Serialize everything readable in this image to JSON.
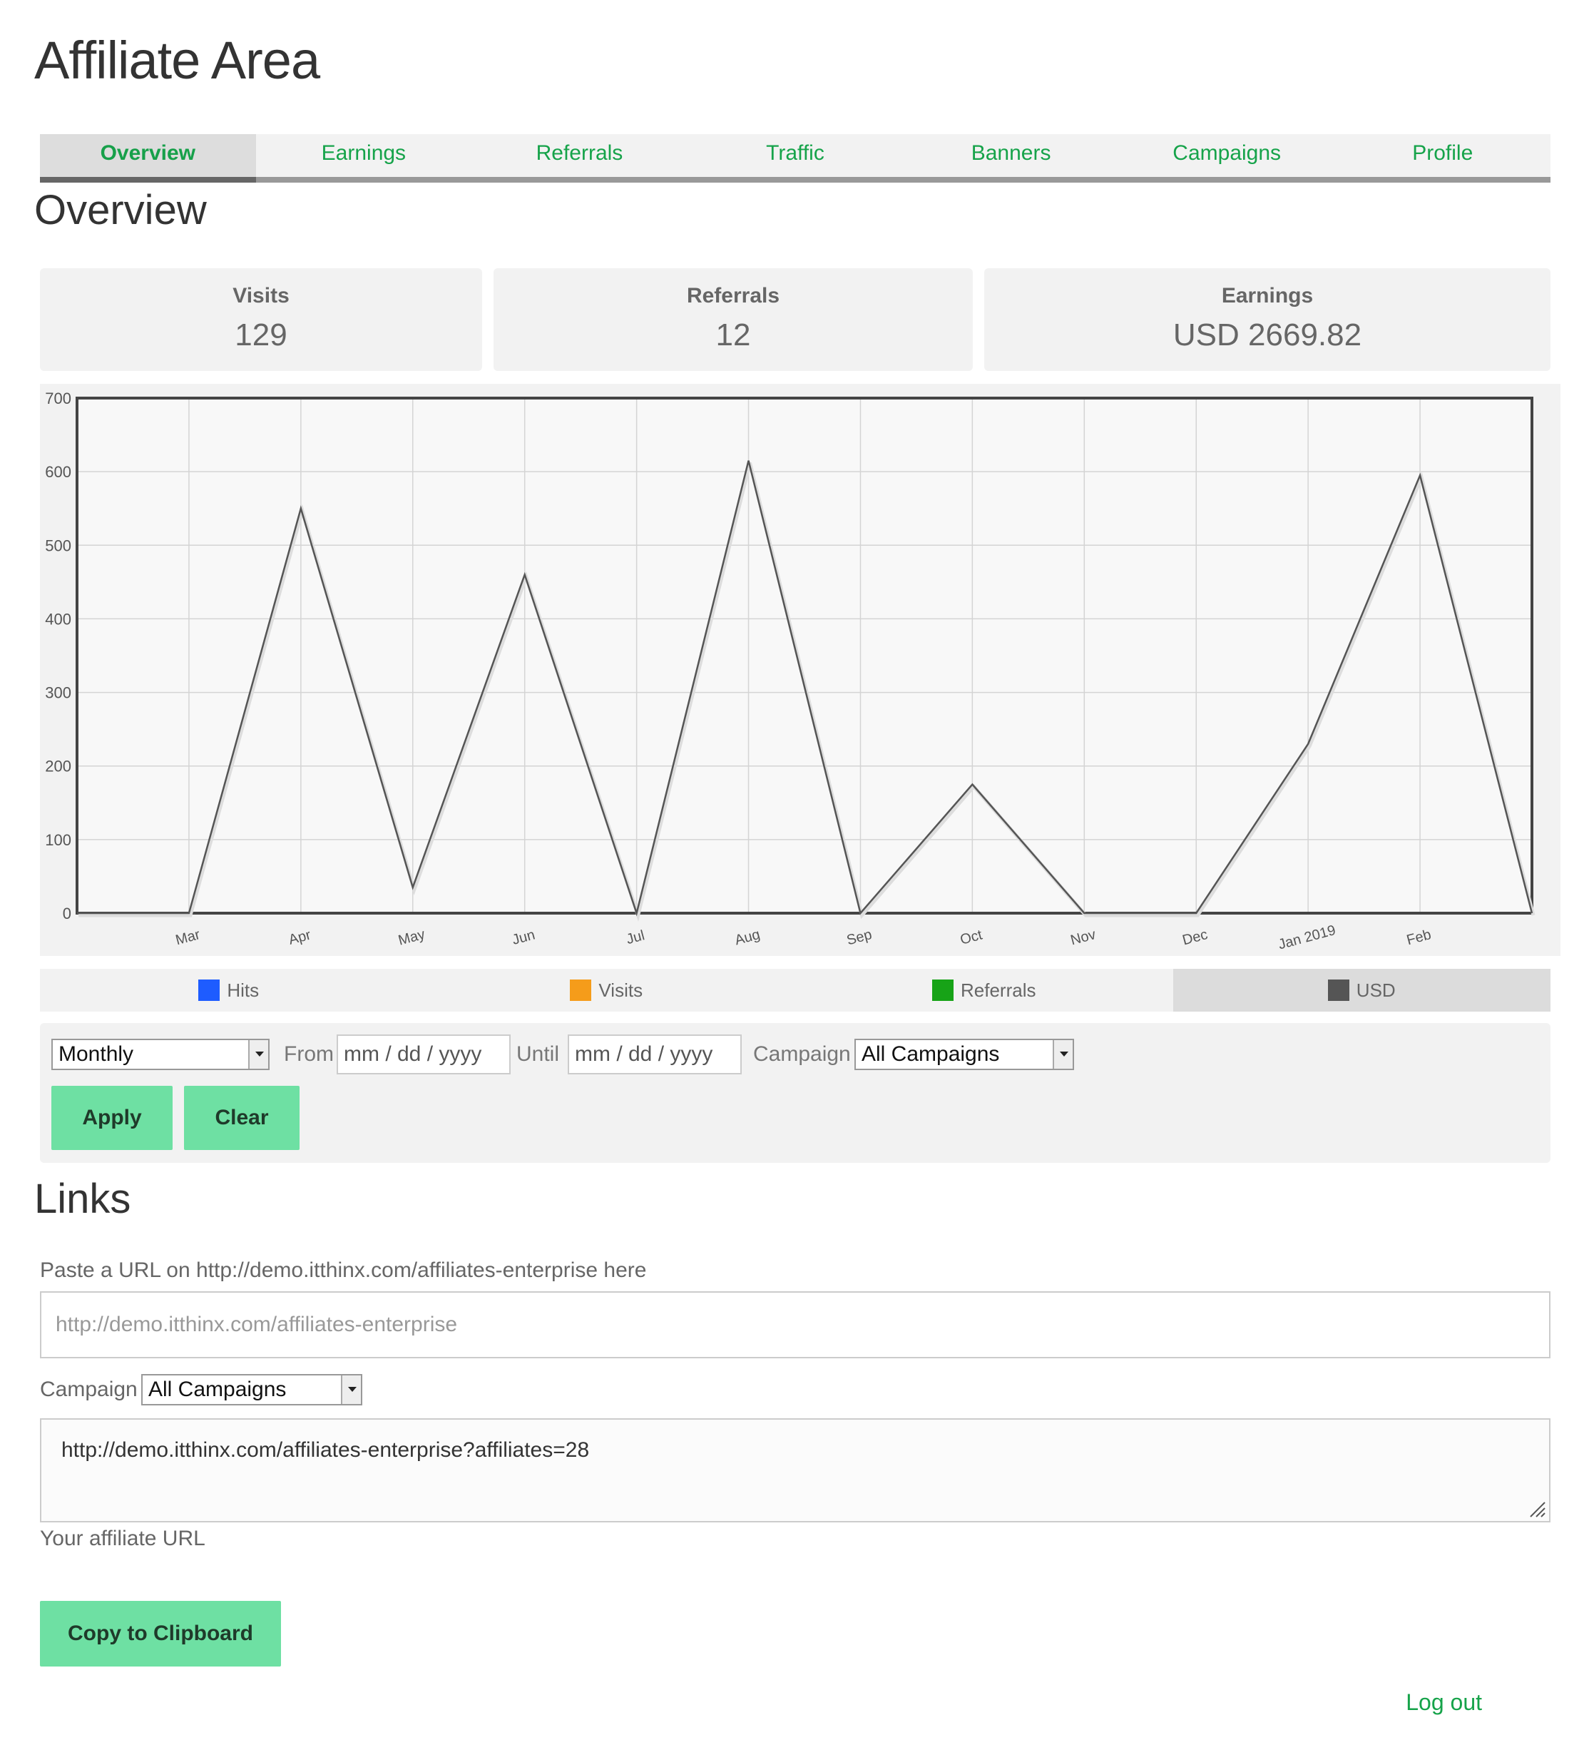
{
  "page_title": "Affiliate Area",
  "tabs": [
    {
      "label": "Overview",
      "active": true
    },
    {
      "label": "Earnings"
    },
    {
      "label": "Referrals"
    },
    {
      "label": "Traffic"
    },
    {
      "label": "Banners"
    },
    {
      "label": "Campaigns"
    },
    {
      "label": "Profile"
    }
  ],
  "overview_title": "Overview",
  "stats": {
    "visits": {
      "label": "Visits",
      "value": "129"
    },
    "referrals": {
      "label": "Referrals",
      "value": "12"
    },
    "earnings": {
      "label": "Earnings",
      "value": "USD 2669.82"
    }
  },
  "chart_data": {
    "type": "line",
    "x": [
      "",
      "Mar",
      "Apr",
      "May",
      "Jun",
      "Jul",
      "Aug",
      "Sep",
      "Oct",
      "Nov",
      "Dec",
      "Jan 2019",
      "Feb",
      ""
    ],
    "series": [
      {
        "name": "USD",
        "color": "#555555",
        "values": [
          0,
          0,
          550,
          35,
          460,
          0,
          615,
          0,
          175,
          0,
          0,
          230,
          595,
          0
        ]
      }
    ],
    "ylim": [
      0,
      700
    ],
    "yticks": [
      0,
      100,
      200,
      300,
      400,
      500,
      600,
      700
    ],
    "grid": true
  },
  "legend": [
    {
      "label": "Hits",
      "color": "#1e5cff",
      "active": false
    },
    {
      "label": "Visits",
      "color": "#f59c1a",
      "active": false
    },
    {
      "label": "Referrals",
      "color": "#17a317",
      "active": false
    },
    {
      "label": "USD",
      "color": "#555555",
      "active": true
    }
  ],
  "filters": {
    "period": "Monthly",
    "from_label": "From",
    "from_value": "mm / dd / yyyy",
    "until_label": "Until",
    "until_value": "mm / dd / yyyy",
    "campaign_label": "Campaign",
    "campaign_value": "All Campaigns",
    "apply_label": "Apply",
    "clear_label": "Clear"
  },
  "links": {
    "title": "Links",
    "url_label": "Paste a URL on http://demo.itthinx.com/affiliates-enterprise here",
    "url_placeholder": "http://demo.itthinx.com/affiliates-enterprise",
    "campaign_label": "Campaign",
    "campaign_value": "All Campaigns",
    "affiliate_url": "http://demo.itthinx.com/affiliates-enterprise?affiliates=28",
    "affiliate_url_caption": "Your affiliate URL",
    "copy_label": "Copy to Clipboard"
  },
  "logout_label": "Log out"
}
